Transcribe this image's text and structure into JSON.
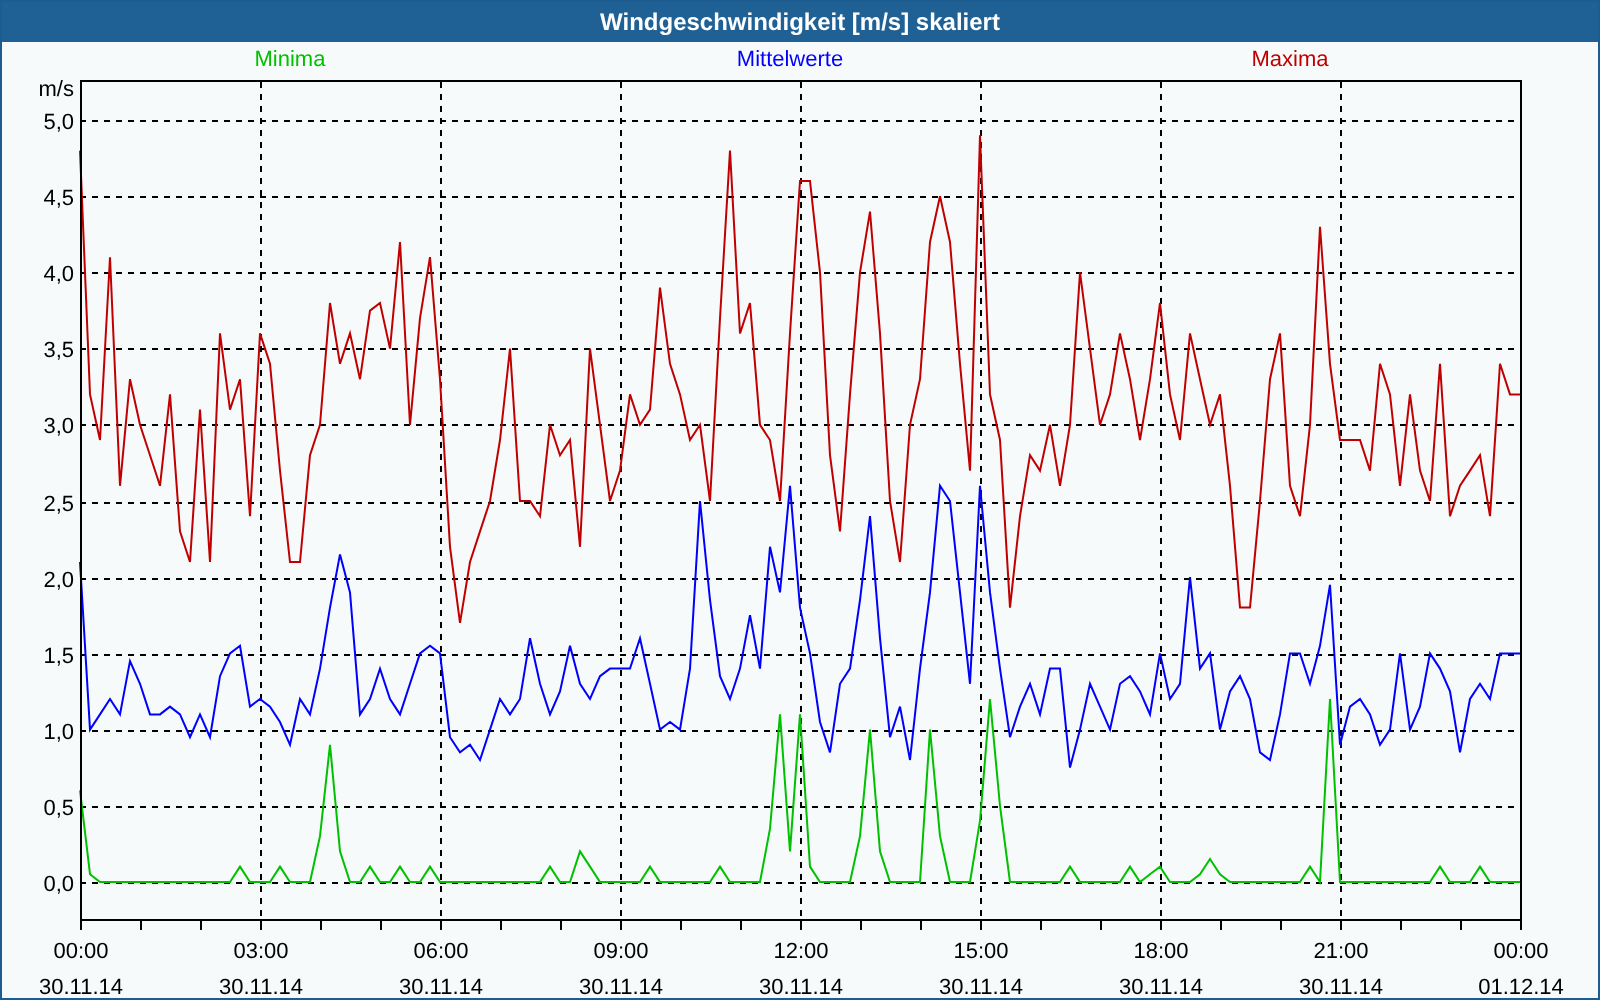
{
  "window": {
    "title": "Windgeschwindigkeit [m/s] skaliert"
  },
  "chart_data": {
    "type": "line",
    "grid": true,
    "ylabel": "m/s",
    "ylim": [
      -0.25,
      5.25
    ],
    "yticks": [
      {
        "value": 0,
        "label": "0,0"
      },
      {
        "value": 0.5,
        "label": "0,5"
      },
      {
        "value": 1,
        "label": "1,0"
      },
      {
        "value": 1.5,
        "label": "1,5"
      },
      {
        "value": 2,
        "label": "2,0"
      },
      {
        "value": 2.5,
        "label": "2,5"
      },
      {
        "value": 3,
        "label": "3,0"
      },
      {
        "value": 3.5,
        "label": "3,5"
      },
      {
        "value": 4,
        "label": "4,0"
      },
      {
        "value": 4.5,
        "label": "4,5"
      },
      {
        "value": 5,
        "label": "5,0"
      }
    ],
    "categories": [
      "00:00\n30.11.14",
      null,
      null,
      null,
      null,
      null,
      null,
      null,
      null,
      null,
      null,
      null,
      null,
      null,
      null,
      null,
      null,
      null,
      "03:00\n30.11.14",
      null,
      null,
      null,
      null,
      null,
      null,
      null,
      null,
      null,
      null,
      null,
      null,
      null,
      null,
      null,
      null,
      null,
      "06:00\n30.11.14",
      null,
      null,
      null,
      null,
      null,
      null,
      null,
      null,
      null,
      null,
      null,
      null,
      null,
      null,
      null,
      null,
      null,
      "09:00\n30.11.14",
      null,
      null,
      null,
      null,
      null,
      null,
      null,
      null,
      null,
      null,
      null,
      null,
      null,
      null,
      null,
      null,
      null,
      "12:00\n30.11.14",
      null,
      null,
      null,
      null,
      null,
      null,
      null,
      null,
      null,
      null,
      null,
      null,
      null,
      null,
      null,
      null,
      null,
      "15:00\n30.11.14",
      null,
      null,
      null,
      null,
      null,
      null,
      null,
      null,
      null,
      null,
      null,
      null,
      null,
      null,
      null,
      null,
      null,
      "18:00\n30.11.14",
      null,
      null,
      null,
      null,
      null,
      null,
      null,
      null,
      null,
      null,
      null,
      null,
      null,
      null,
      null,
      null,
      null,
      "21:00\n30.11.14",
      null,
      null,
      null,
      null,
      null,
      null,
      null,
      null,
      null,
      null,
      null,
      null,
      null,
      null,
      null,
      null,
      null,
      "00:00\n01.12.14"
    ],
    "series": [
      {
        "name": "Minima",
        "color": "#00c000",
        "values": [
          0.6,
          0.05,
          0,
          0,
          0,
          0,
          0,
          0,
          0,
          0,
          0,
          0,
          0,
          0,
          0,
          0,
          0.1,
          0,
          0,
          0,
          0.1,
          0,
          0,
          0,
          0.3,
          0.9,
          0.2,
          0,
          0,
          0.1,
          0,
          0,
          0.1,
          0,
          0,
          0.1,
          0,
          0,
          0,
          0,
          0,
          0,
          0,
          0,
          0,
          0,
          0,
          0.1,
          0,
          0,
          0.2,
          0.1,
          0,
          0,
          0,
          0,
          0,
          0.1,
          0,
          0,
          0,
          0,
          0,
          0,
          0.1,
          0,
          0,
          0,
          0,
          0.35,
          1.1,
          0.2,
          1.1,
          0.1,
          0,
          0,
          0,
          0,
          0.3,
          1.0,
          0.2,
          0,
          0,
          0,
          0,
          1.0,
          0.3,
          0,
          0,
          0,
          0.4,
          1.2,
          0.5,
          0,
          0,
          0,
          0,
          0,
          0,
          0.1,
          0,
          0,
          0,
          0,
          0,
          0.1,
          0,
          0.05,
          0.1,
          0,
          0,
          0,
          0.05,
          0.15,
          0.05,
          0,
          0,
          0,
          0,
          0,
          0,
          0,
          0,
          0.1,
          0,
          1.2,
          0,
          0,
          0,
          0,
          0,
          0,
          0,
          0,
          0,
          0,
          0.1,
          0,
          0,
          0,
          0.1,
          0,
          0,
          0,
          0
        ]
      },
      {
        "name": "Mittelwerte",
        "color": "#0000ff",
        "values": [
          2.1,
          1.0,
          1.1,
          1.2,
          1.1,
          1.45,
          1.3,
          1.1,
          1.1,
          1.15,
          1.1,
          0.95,
          1.1,
          0.95,
          1.35,
          1.5,
          1.55,
          1.15,
          1.2,
          1.15,
          1.05,
          0.9,
          1.2,
          1.1,
          1.4,
          1.8,
          2.15,
          1.9,
          1.1,
          1.2,
          1.4,
          1.2,
          1.1,
          1.3,
          1.5,
          1.55,
          1.5,
          0.95,
          0.85,
          0.9,
          0.8,
          1.0,
          1.2,
          1.1,
          1.2,
          1.6,
          1.3,
          1.1,
          1.25,
          1.55,
          1.3,
          1.2,
          1.35,
          1.4,
          1.4,
          1.4,
          1.6,
          1.3,
          1.0,
          1.05,
          1.0,
          1.4,
          2.5,
          1.85,
          1.35,
          1.2,
          1.4,
          1.75,
          1.4,
          2.2,
          1.9,
          2.6,
          1.8,
          1.5,
          1.05,
          0.85,
          1.3,
          1.4,
          1.85,
          2.4,
          1.6,
          0.95,
          1.15,
          0.8,
          1.4,
          1.9,
          2.6,
          2.5,
          1.9,
          1.3,
          2.6,
          1.9,
          1.4,
          0.95,
          1.15,
          1.3,
          1.1,
          1.4,
          1.4,
          0.75,
          1.0,
          1.3,
          1.15,
          1.0,
          1.3,
          1.35,
          1.25,
          1.1,
          1.5,
          1.2,
          1.3,
          2.0,
          1.4,
          1.5,
          1.0,
          1.25,
          1.35,
          1.2,
          0.85,
          0.8,
          1.1,
          1.5,
          1.5,
          1.3,
          1.55,
          1.95,
          0.9,
          1.15,
          1.2,
          1.1,
          0.9,
          1.0,
          1.5,
          1.0,
          1.15,
          1.5,
          1.4,
          1.25,
          0.85,
          1.2,
          1.3,
          1.2,
          1.5,
          1.5,
          1.5
        ]
      },
      {
        "name": "Maxima",
        "color": "#c00000",
        "values": [
          4.8,
          3.2,
          2.9,
          4.1,
          2.6,
          3.3,
          3.0,
          2.8,
          2.6,
          3.2,
          2.3,
          2.1,
          3.1,
          2.1,
          3.6,
          3.1,
          3.3,
          2.4,
          3.6,
          3.4,
          2.7,
          2.1,
          2.1,
          2.8,
          3.0,
          3.8,
          3.4,
          3.6,
          3.3,
          3.75,
          3.8,
          3.5,
          4.2,
          3.0,
          3.7,
          4.1,
          3.3,
          2.2,
          1.7,
          2.1,
          2.3,
          2.5,
          2.9,
          3.5,
          2.5,
          2.5,
          2.4,
          3.0,
          2.8,
          2.9,
          2.2,
          3.5,
          3.0,
          2.5,
          2.7,
          3.2,
          3.0,
          3.1,
          3.9,
          3.4,
          3.2,
          2.9,
          3.0,
          2.5,
          3.7,
          4.8,
          3.6,
          3.8,
          3.0,
          2.9,
          2.5,
          3.6,
          4.6,
          4.6,
          4.0,
          2.8,
          2.3,
          3.2,
          4.0,
          4.4,
          3.6,
          2.5,
          2.1,
          3.0,
          3.3,
          4.2,
          4.5,
          4.2,
          3.4,
          2.7,
          4.9,
          3.2,
          2.9,
          1.8,
          2.4,
          2.8,
          2.7,
          3.0,
          2.6,
          3.0,
          4.0,
          3.5,
          3.0,
          3.2,
          3.6,
          3.3,
          2.9,
          3.3,
          3.8,
          3.2,
          2.9,
          3.6,
          3.3,
          3.0,
          3.2,
          2.6,
          1.8,
          1.8,
          2.5,
          3.3,
          3.6,
          2.6,
          2.4,
          3.0,
          4.3,
          3.4,
          2.9,
          2.9,
          2.9,
          2.7,
          3.4,
          3.2,
          2.6,
          3.2,
          2.7,
          2.5,
          3.4,
          2.4,
          2.6,
          2.7,
          2.8,
          2.4,
          3.4,
          3.2,
          3.2
        ]
      }
    ]
  }
}
